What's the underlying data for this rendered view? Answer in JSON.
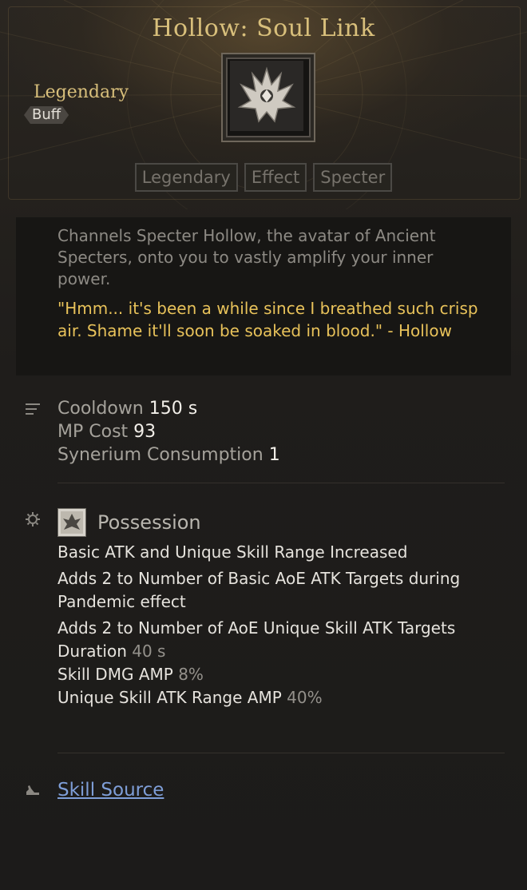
{
  "skill": {
    "title": "Hollow: Soul Link",
    "rarity": "Legendary",
    "type": "Buff",
    "icon": "specter-crest-icon",
    "tags": [
      "Legendary",
      "Effect",
      "Specter"
    ]
  },
  "description": {
    "text": "Channels Specter Hollow, the avatar of Ancient Specters, onto you to vastly amplify your inner power.",
    "quote": "\"Hmm... it's been a while since I breathed such crisp air. Shame it'll soon be soaked in blood.\" - Hollow"
  },
  "stats": {
    "cooldown_label": "Cooldown",
    "cooldown_value": "150 s",
    "mp_label": "MP Cost",
    "mp_value": "93",
    "synerium_label": "Synerium Consumption",
    "synerium_value": "1"
  },
  "possession": {
    "title": "Possession",
    "icon": "possession-icon",
    "effects": [
      "Basic ATK and Unique Skill Range Increased",
      "Adds 2 to Number of Basic AoE ATK Targets during Pandemic effect",
      "Adds 2 to Number of AoE Unique Skill ATK Targets"
    ],
    "duration_label": "Duration",
    "duration_value": "40 s",
    "dmg_amp_label": "Skill DMG AMP",
    "dmg_amp_value": "8%",
    "range_amp_label": "Unique Skill ATK Range AMP",
    "range_amp_value": "40%"
  },
  "footer": {
    "source_link": "Skill Source"
  },
  "colors": {
    "title_gold": "#d8bf7b",
    "quote_yellow": "#e8c25a",
    "link_blue": "#7e9ed7"
  }
}
